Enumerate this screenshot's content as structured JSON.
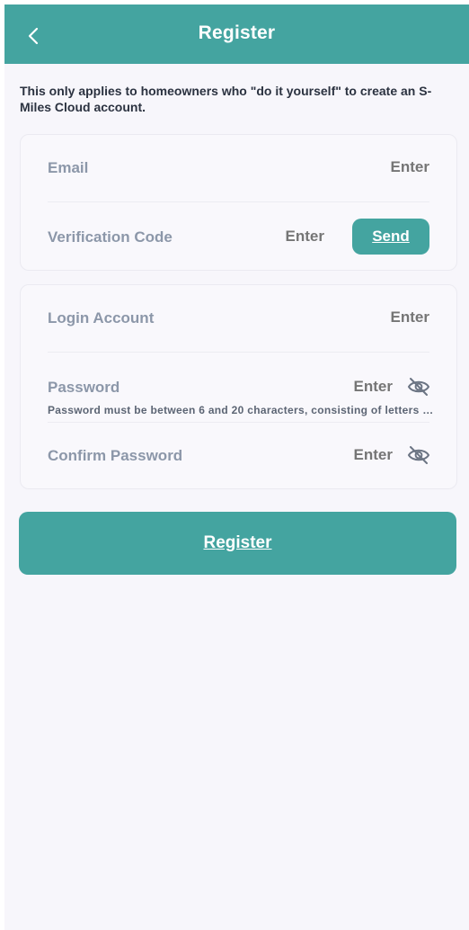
{
  "header": {
    "title": "Register",
    "back_icon": "chevron-left-icon",
    "background": "#44a4a0"
  },
  "note": "This only applies to homeowners who \"do it yourself\" to create an S-Miles Cloud account.",
  "email_card": {
    "email": {
      "label": "Email",
      "placeholder": "Enter",
      "value": ""
    },
    "verification_code": {
      "label": "Verification Code",
      "placeholder": "Enter",
      "value": "",
      "send_label": "Send"
    }
  },
  "account_card": {
    "login_account": {
      "label": "Login Account",
      "placeholder": "Enter",
      "value": ""
    },
    "password": {
      "label": "Password",
      "placeholder": "Enter",
      "value": "",
      "hint": "Password must be between 6 and 20 characters, consisting of letters and numbers",
      "icon": "eye-slash-icon"
    },
    "confirm_password": {
      "label": "Confirm Password",
      "placeholder": "Enter",
      "value": "",
      "icon": "eye-slash-icon"
    }
  },
  "register_button": "Register",
  "colors": {
    "accent": "#44a4a0",
    "label": "#8c97a9",
    "placeholder": "#c4c8d0",
    "background": "#f7f6fb"
  }
}
